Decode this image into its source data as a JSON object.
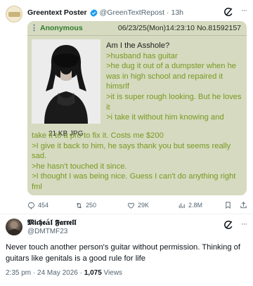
{
  "original_tweet": {
    "author_name": "Greentext Poster",
    "handle": "@GreenTextRepost",
    "separator": "·",
    "time": "13h",
    "avatar_icon": "greentext-logo-icon",
    "verified_color": "#1d9bf0",
    "post": {
      "menu_icon": "post-menu-icon",
      "poster_name": "Anonymous",
      "meta": "06/23/25(Mon)14:23:10 No.81592157",
      "image_caption": "21 KB JPG",
      "lines_beside_image": [
        {
          "text": "Am I the Asshole?",
          "kind": "title"
        },
        {
          "text": ">husband has guitar",
          "kind": "gt"
        },
        {
          "text": ">he dug it out of a dumpster when he was in high school and repaired it himsrlf",
          "kind": "gt"
        },
        {
          "text": ">it is super rough looking. But he loves it",
          "kind": "gt"
        },
        {
          "text": ">i take it without him knowing and",
          "kind": "gt"
        }
      ],
      "lines_below_image": [
        {
          "text": "take it to a pro to fix it. Costs me $200",
          "kind": "gt"
        },
        {
          "text": ">I give it back to him, he says thank you but seems really sad.",
          "kind": "gt"
        },
        {
          "text": ">he hasn't touched it since.",
          "kind": "gt"
        },
        {
          "text": ">I thought I was being nice. Guess I can't do anything right fml",
          "kind": "gt"
        }
      ],
      "colors": {
        "background": "#d6dac0",
        "name": "#2e7d2e",
        "greentext": "#789922"
      }
    },
    "stats": {
      "replies": "454",
      "retweets": "250",
      "likes": "29K",
      "views": "2.8M"
    }
  },
  "reply_tweet": {
    "author_name": "𝕸𝖎𝖈𝖍𝖊á𝖑 𝕱𝖆𝖗𝖗𝖊𝖑𝖑",
    "handle": "@DMTMF23",
    "text": "Never touch another person's guitar without permission.  Thinking of guitars like genitals is a good rule for life",
    "timestamp": "2:35 pm · 24 May 2026 · ",
    "views": "1,075",
    "views_suffix": " Views"
  }
}
